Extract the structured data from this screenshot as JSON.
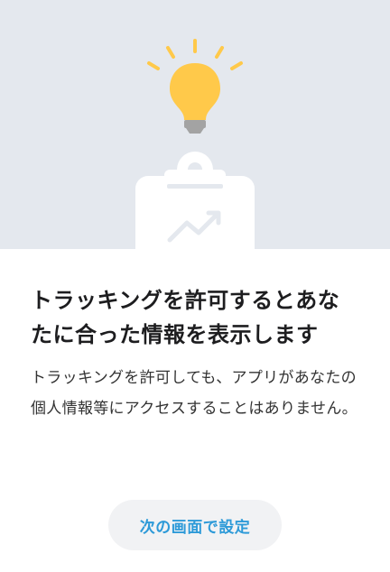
{
  "hero": {
    "illustration": "lightbulb-clipboard-illustration",
    "colors": {
      "background": "#e4e8ee",
      "bulb": "#ffc94a",
      "bulb_base": "#a3a3a3",
      "clipboard": "#ffffff",
      "clipboard_detail": "#e4e8ee"
    }
  },
  "dialog": {
    "title": "トラッキングを許可するとあなたに合った情報を表示します",
    "body": "トラッキングを許可しても、アプリがあなたの個人情報等にアクセスすることはありません。",
    "next_button_label": "次の画面で設定",
    "accent_color": "#2d9ad8"
  }
}
